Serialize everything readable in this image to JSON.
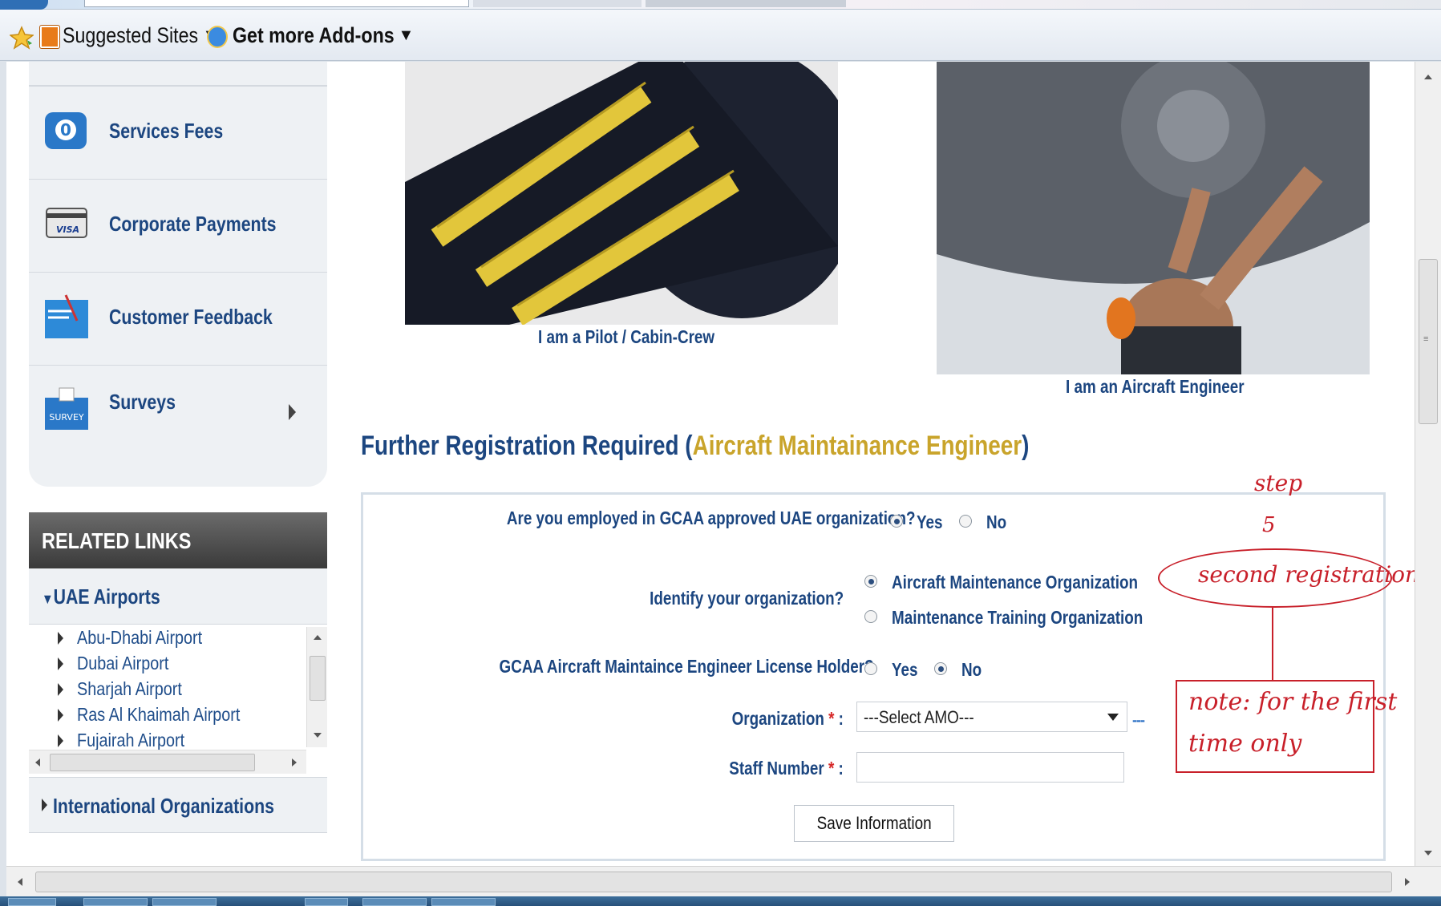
{
  "favorites_bar": {
    "suggested_sites": "Suggested Sites",
    "get_addons": "Get more Add-ons"
  },
  "sidebar": {
    "services": [
      {
        "label": "Services Fees",
        "icon": "fees-icon"
      },
      {
        "label": "Corporate Payments",
        "icon": "visa-card-icon"
      },
      {
        "label": "Customer Feedback",
        "icon": "feedback-icon"
      },
      {
        "label": "Surveys",
        "icon": "survey-icon"
      }
    ],
    "related_links_title": "RELATED LINKS",
    "uae_airports_title": "UAE Airports",
    "airports": [
      "Abu-Dhabi Airport",
      "Dubai Airport",
      "Sharjah Airport",
      "Ras Al Khaimah Airport",
      "Fujairah Airport"
    ],
    "international_title": "International Organizations"
  },
  "main": {
    "pilot_caption": "I am a Pilot / Cabin-Crew",
    "engineer_caption": "I am an Aircraft Engineer",
    "section_title_prefix": "Further Registration Required (",
    "section_title_highlight": "Aircraft Maintainance Engineer",
    "section_title_suffix": ")",
    "form": {
      "q_employed": "Are you employed in GCAA approved UAE organization?",
      "employed_yes": "Yes",
      "employed_no": "No",
      "employed_selected": "Yes",
      "q_identify": "Identify your organization?",
      "org_option_1": "Aircraft Maintenance Organization",
      "org_option_2": "Maintenance Training Organization",
      "org_selected": "Aircraft Maintenance Organization",
      "q_license": "GCAA Aircraft Maintaince Engineer License Holder?",
      "license_yes": "Yes",
      "license_no": "No",
      "license_selected": "No",
      "organization_label": "Organization",
      "organization_value": "---Select AMO---",
      "organization_dashes": "---",
      "staff_label": "Staff Number",
      "required_mark": "*",
      "colon": ":",
      "staff_value": "",
      "save_button": "Save Information"
    }
  },
  "annotations": {
    "step": "step",
    "step_number": "5",
    "second_registration": "second registration",
    "note_line1": "note: for the first",
    "note_line2": "time only"
  },
  "colors": {
    "link_blue": "#1c4680",
    "highlight_gold": "#c9a42b",
    "annotation_red": "#c8202a"
  }
}
